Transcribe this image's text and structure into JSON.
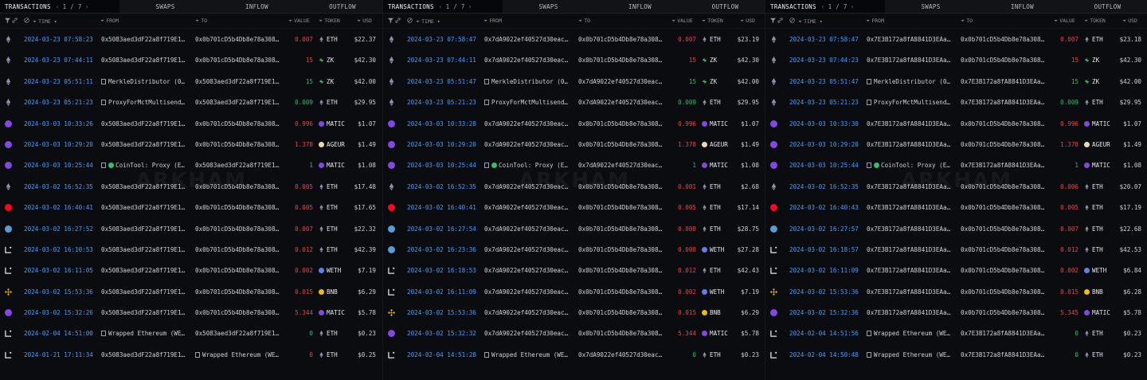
{
  "tabs": {
    "transactions": "TRANSACTIONS",
    "pager": "1 / 7",
    "swaps": "SWAPS",
    "inflow": "INFLOW",
    "outflow": "OUTFLOW"
  },
  "columns": {
    "time": "TIME",
    "from": "FROM",
    "to": "TO",
    "value": "VALUE",
    "token": "TOKEN",
    "usd": "USD"
  },
  "watermark": "ARKHAM",
  "colors": {
    "link": "#4a9fff",
    "negative": "#e5484d",
    "positive": "#2fbf71",
    "background": "#0b0c10"
  },
  "panels": [
    {
      "rows": [
        {
          "icon": "eth",
          "time": "2024-03-23 07:58:23",
          "from": "0x5083aed3dF22a8f719E1…",
          "to": "0x0b701cD5b4Db8e78a308…",
          "value": "0.007",
          "dir": "out",
          "token": "ETH",
          "usd": "$22.37"
        },
        {
          "icon": "eth",
          "time": "2024-03-23 07:44:11",
          "from": "0x5083aed3dF22a8f719E1…",
          "to": "0x0b701cD5b4Db8e78a308…",
          "value": "15",
          "dir": "out",
          "token": "ZK",
          "usd": "$42.30"
        },
        {
          "icon": "eth",
          "time": "2024-03-23 05:51:11",
          "from": "MerkleDistributor (0…",
          "from_entity": true,
          "to": "0x5083aed3dF22a8f719E1…",
          "value": "15",
          "dir": "in",
          "token": "ZK",
          "usd": "$42.00"
        },
        {
          "icon": "eth",
          "time": "2024-03-23 05:21:23",
          "from": "ProxyForMctMultisend…",
          "from_entity": true,
          "to": "0x5083aed3dF22a8f719E1…",
          "value": "0.009",
          "dir": "in",
          "token": "ETH",
          "usd": "$29.95"
        },
        {
          "icon": "polygon",
          "time": "2024-03-03 10:33:26",
          "from": "0x5083aed3dF22a8f719E1…",
          "to": "0x0b701cD5b4Db8e78a308…",
          "value": "0.996",
          "dir": "out",
          "token": "MATIC",
          "usd": "$1.07"
        },
        {
          "icon": "polygon",
          "time": "2024-03-03 10:29:20",
          "from": "0x5083aed3dF22a8f719E1…",
          "to": "0x0b701cD5b4Db8e78a308…",
          "value": "1.378",
          "dir": "out",
          "token": "AGEUR",
          "usd": "$1.49"
        },
        {
          "icon": "polygon",
          "time": "2024-03-03 10:25:44",
          "from": "CoinTool: Proxy (E…",
          "from_entity": true,
          "from_cointool": true,
          "to": "0x5083aed3dF22a8f719E1…",
          "value": "1",
          "dir": "in",
          "token": "MATIC",
          "usd": "$1.08"
        },
        {
          "icon": "eth",
          "time": "2024-03-02 16:52:35",
          "from": "0x5083aed3dF22a8f719E1…",
          "to": "0x0b701cD5b4Db8e78a308…",
          "value": "0.005",
          "dir": "out",
          "token": "ETH",
          "usd": "$17.48"
        },
        {
          "icon": "optimism",
          "time": "2024-03-02 16:40:41",
          "from": "0x5083aed3dF22a8f719E1…",
          "to": "0x0b701cD5b4Db8e78a308…",
          "value": "0.005",
          "dir": "out",
          "token": "ETH",
          "usd": "$17.65"
        },
        {
          "icon": "base",
          "time": "2024-03-02 16:27:52",
          "from": "0x5083aed3dF22a8f719E1…",
          "to": "0x0b701cD5b4Db8e78a308…",
          "value": "0.007",
          "dir": "out",
          "token": "ETH",
          "usd": "$22.32"
        },
        {
          "icon": "linea",
          "time": "2024-03-02 16:10:53",
          "from": "0x5083aed3dF22a8f719E1…",
          "to": "0x0b701cD5b4Db8e78a308…",
          "value": "0.012",
          "dir": "out",
          "token": "ETH",
          "usd": "$42.39"
        },
        {
          "icon": "linea",
          "time": "2024-03-02 16:11:05",
          "from": "0x5083aed3dF22a8f719E1…",
          "to": "0x0b701cD5b4Db8e78a308…",
          "value": "0.002",
          "dir": "out",
          "token": "WETH",
          "usd": "$7.19"
        },
        {
          "icon": "bsc",
          "time": "2024-03-02 15:53:36",
          "from": "0x5083aed3dF22a8f719E1…",
          "to": "0x0b701cD5b4Db8e78a308…",
          "value": "0.015",
          "dir": "out",
          "token": "BNB",
          "usd": "$6.29"
        },
        {
          "icon": "polygon",
          "time": "2024-03-02 15:32:26",
          "from": "0x5083aed3dF22a8f719E1…",
          "to": "0x0b701cD5b4Db8e78a308…",
          "value": "5.344",
          "dir": "out",
          "token": "MATIC",
          "usd": "$5.78"
        },
        {
          "icon": "linea",
          "time": "2024-02-04 14:51:00",
          "from": "Wrapped Ethereum (WE…",
          "from_entity": true,
          "to": "0x5083aed3dF22a8f719E1…",
          "value": "0",
          "dir": "in",
          "token": "ETH",
          "usd": "$0.23"
        },
        {
          "icon": "linea",
          "time": "2024-01-21 17:11:34",
          "from": "0x5083aed3dF22a8f719E1…",
          "to": "Wrapped Ethereum (WE…",
          "to_entity": true,
          "value": "0",
          "dir": "out",
          "token": "ETH",
          "usd": "$0.25"
        }
      ]
    },
    {
      "rows": [
        {
          "icon": "eth",
          "time": "2024-03-23 07:58:47",
          "from": "0x7dA9022ef40527d30eac…",
          "to": "0x0b701cD5b4Db8e78a308…",
          "value": "0.007",
          "dir": "out",
          "token": "ETH",
          "usd": "$23.19"
        },
        {
          "icon": "eth",
          "time": "2024-03-23 07:44:11",
          "from": "0x7dA9022ef40527d30eac…",
          "to": "0x0b701cD5b4Db8e78a308…",
          "value": "15",
          "dir": "out",
          "token": "ZK",
          "usd": "$42.30"
        },
        {
          "icon": "eth",
          "time": "2024-03-23 05:51:47",
          "from": "MerkleDistributor (0…",
          "from_entity": true,
          "to": "0x7dA9022ef40527d30eac…",
          "value": "15",
          "dir": "in",
          "token": "ZK",
          "usd": "$42.00"
        },
        {
          "icon": "eth",
          "time": "2024-03-23 05:21:23",
          "from": "ProxyForMctMultisend…",
          "from_entity": true,
          "to": "0x7dA9022ef40527d30eac…",
          "value": "0.009",
          "dir": "in",
          "token": "ETH",
          "usd": "$29.95"
        },
        {
          "icon": "polygon",
          "time": "2024-03-03 10:33:28",
          "from": "0x7dA9022ef40527d30eac…",
          "to": "0x0b701cD5b4Db8e78a308…",
          "value": "0.996",
          "dir": "out",
          "token": "MATIC",
          "usd": "$1.07"
        },
        {
          "icon": "polygon",
          "time": "2024-03-03 10:29:20",
          "from": "0x7dA9022ef40527d30eac…",
          "to": "0x0b701cD5b4Db8e78a308…",
          "value": "1.378",
          "dir": "out",
          "token": "AGEUR",
          "usd": "$1.49"
        },
        {
          "icon": "polygon",
          "time": "2024-03-03 10:25:44",
          "from": "CoinTool: Proxy (E…",
          "from_entity": true,
          "from_cointool": true,
          "to": "0x7dA9022ef40527d30eac…",
          "value": "1",
          "dir": "in",
          "token": "MATIC",
          "usd": "$1.08"
        },
        {
          "icon": "eth",
          "time": "2024-03-02 16:52:35",
          "from": "0x7dA9022ef40527d30eac…",
          "to": "0x0b701cD5b4Db8e78a308…",
          "value": "0.001",
          "dir": "out",
          "token": "ETH",
          "usd": "$2.68"
        },
        {
          "icon": "optimism",
          "time": "2024-03-02 16:40:41",
          "from": "0x7dA9022ef40527d30eac…",
          "to": "0x0b701cD5b4Db8e78a308…",
          "value": "0.005",
          "dir": "out",
          "token": "ETH",
          "usd": "$17.14"
        },
        {
          "icon": "base",
          "time": "2024-03-02 16:27:54",
          "from": "0x7dA9022ef40527d30eac…",
          "to": "0x0b701cD5b4Db8e78a308…",
          "value": "0.008",
          "dir": "out",
          "token": "ETH",
          "usd": "$28.75"
        },
        {
          "icon": "base",
          "time": "2024-03-02 16:23:36",
          "from": "0x7dA9022ef40527d30eac…",
          "to": "0x0b701cD5b4Db8e78a308…",
          "value": "0.008",
          "dir": "out",
          "token": "WETH",
          "usd": "$27.28"
        },
        {
          "icon": "linea",
          "time": "2024-03-02 16:18:53",
          "from": "0x7dA9022ef40527d30eac…",
          "to": "0x0b701cD5b4Db8e78a308…",
          "value": "0.012",
          "dir": "out",
          "token": "ETH",
          "usd": "$42.43"
        },
        {
          "icon": "linea",
          "time": "2024-03-02 16:11:09",
          "from": "0x7dA9022ef40527d30eac…",
          "to": "0x0b701cD5b4Db8e78a308…",
          "value": "0.002",
          "dir": "out",
          "token": "WETH",
          "usd": "$7.19"
        },
        {
          "icon": "bsc",
          "time": "2024-03-02 15:53:36",
          "from": "0x7dA9022ef40527d30eac…",
          "to": "0x0b701cD5b4Db8e78a308…",
          "value": "0.015",
          "dir": "out",
          "token": "BNB",
          "usd": "$6.29"
        },
        {
          "icon": "polygon",
          "time": "2024-03-02 15:32:32",
          "from": "0x7dA9022ef40527d30eac…",
          "to": "0x0b701cD5b4Db8e78a308…",
          "value": "5.344",
          "dir": "out",
          "token": "MATIC",
          "usd": "$5.78"
        },
        {
          "icon": "linea",
          "time": "2024-02-04 14:51:28",
          "from": "Wrapped Ethereum (WE…",
          "from_entity": true,
          "to": "0x7dA9022ef40527d30eac…",
          "value": "0",
          "dir": "in",
          "token": "ETH",
          "usd": "$0.23"
        }
      ]
    },
    {
      "rows": [
        {
          "icon": "eth",
          "time": "2024-03-23 07:58:47",
          "from": "0x7E3B172a8fA8841D3EAa…",
          "to": "0x0b701cD5b4Db8e78a308…",
          "value": "0.007",
          "dir": "out",
          "token": "ETH",
          "usd": "$23.18"
        },
        {
          "icon": "eth",
          "time": "2024-03-23 07:44:23",
          "from": "0x7E3B172a8fA8841D3EAa…",
          "to": "0x0b701cD5b4Db8e78a308…",
          "value": "15",
          "dir": "out",
          "token": "ZK",
          "usd": "$42.30"
        },
        {
          "icon": "eth",
          "time": "2024-03-23 05:51:47",
          "from": "MerkleDistributor (0…",
          "from_entity": true,
          "to": "0x7E3B172a8fA8841D3EAa…",
          "value": "15",
          "dir": "in",
          "token": "ZK",
          "usd": "$42.00"
        },
        {
          "icon": "eth",
          "time": "2024-03-23 05:21:23",
          "from": "ProxyForMctMultisend…",
          "from_entity": true,
          "to": "0x7E3B172a8fA8841D3EAa…",
          "value": "0.009",
          "dir": "in",
          "token": "ETH",
          "usd": "$29.95"
        },
        {
          "icon": "polygon",
          "time": "2024-03-03 10:33:30",
          "from": "0x7E3B172a8fA8841D3EAa…",
          "to": "0x0b701cD5b4Db8e78a308…",
          "value": "0.996",
          "dir": "out",
          "token": "MATIC",
          "usd": "$1.07"
        },
        {
          "icon": "polygon",
          "time": "2024-03-03 10:29:20",
          "from": "0x7E3B172a8fA8841D3EAa…",
          "to": "0x0b701cD5b4Db8e78a308…",
          "value": "1.378",
          "dir": "out",
          "token": "AGEUR",
          "usd": "$1.49"
        },
        {
          "icon": "polygon",
          "time": "2024-03-03 10:25:44",
          "from": "CoinTool: Proxy (E…",
          "from_entity": true,
          "from_cointool": true,
          "to": "0x7E3B172a8fA8841D3EAa…",
          "value": "1",
          "dir": "in",
          "token": "MATIC",
          "usd": "$1.08"
        },
        {
          "icon": "eth",
          "time": "2024-03-02 16:52:35",
          "from": "0x7E3B172a8fA8841D3EAa…",
          "to": "0x0b701cD5b4Db8e78a308…",
          "value": "0.006",
          "dir": "out",
          "token": "ETH",
          "usd": "$20.07"
        },
        {
          "icon": "optimism",
          "time": "2024-03-02 16:40:43",
          "from": "0x7E3B172a8fA8841D3EAa…",
          "to": "0x0b701cD5b4Db8e78a308…",
          "value": "0.005",
          "dir": "out",
          "token": "ETH",
          "usd": "$17.19"
        },
        {
          "icon": "base",
          "time": "2024-03-02 16:27:57",
          "from": "0x7E3B172a8fA8841D3EAa…",
          "to": "0x0b701cD5b4Db8e78a308…",
          "value": "0.007",
          "dir": "out",
          "token": "ETH",
          "usd": "$22.68"
        },
        {
          "icon": "linea",
          "time": "2024-03-02 16:18:57",
          "from": "0x7E3B172a8fA8841D3EAa…",
          "to": "0x0b701cD5b4Db8e78a308…",
          "value": "0.012",
          "dir": "out",
          "token": "ETH",
          "usd": "$42.53"
        },
        {
          "icon": "linea",
          "time": "2024-03-02 16:11:09",
          "from": "0x7E3B172a8fA8841D3EAa…",
          "to": "0x0b701cD5b4Db8e78a308…",
          "value": "0.002",
          "dir": "out",
          "token": "WETH",
          "usd": "$6.84"
        },
        {
          "icon": "bsc",
          "time": "2024-03-02 15:53:36",
          "from": "0x7E3B172a8fA8841D3EAa…",
          "to": "0x0b701cD5b4Db8e78a308…",
          "value": "0.015",
          "dir": "out",
          "token": "BNB",
          "usd": "$6.28"
        },
        {
          "icon": "polygon",
          "time": "2024-03-02 15:32:36",
          "from": "0x7E3B172a8fA8841D3EAa…",
          "to": "0x0b701cD5b4Db8e78a308…",
          "value": "5.345",
          "dir": "out",
          "token": "MATIC",
          "usd": "$5.78"
        },
        {
          "icon": "linea",
          "time": "2024-02-04 14:51:56",
          "from": "Wrapped Ethereum (WE…",
          "from_entity": true,
          "to": "0x7E3B172a8fA8841D3EAa…",
          "value": "0",
          "dir": "in",
          "token": "ETH",
          "usd": "$0.23"
        },
        {
          "icon": "linea",
          "time": "2024-02-04 14:50:48",
          "from": "Wrapped Ethereum (WE…",
          "from_entity": true,
          "to": "0x7E3B172a8fA8841D3EAa…",
          "value": "0",
          "dir": "in",
          "token": "ETH",
          "usd": "$0.23"
        }
      ]
    }
  ]
}
